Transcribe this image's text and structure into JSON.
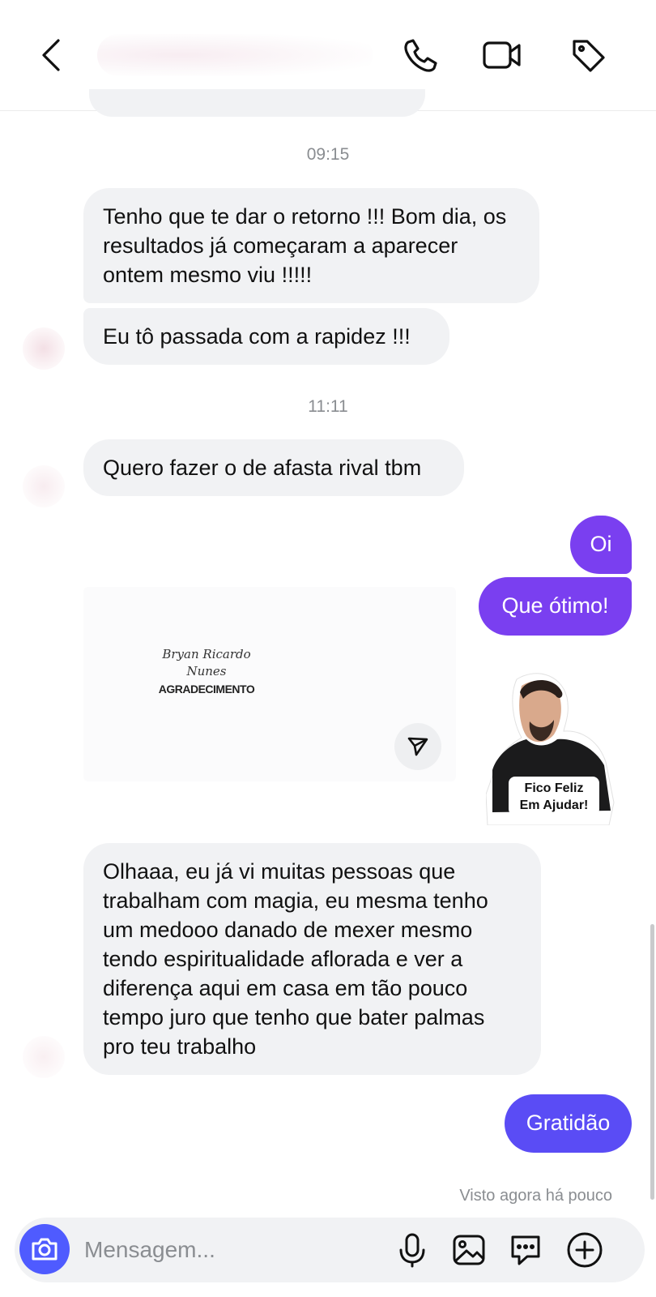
{
  "header": {
    "back_icon": "chevron-left-icon",
    "actions": [
      "phone-icon",
      "video-icon",
      "tag-icon"
    ]
  },
  "colors": {
    "outgoing_bubble": "#7a3ff0",
    "outgoing_bubble_alt": "#5a4cf5",
    "incoming_bubble": "#f1f2f4",
    "camera_button": "#4f5bff"
  },
  "timestamps": [
    "09:15",
    "11:11"
  ],
  "messages": [
    {
      "from": "them",
      "text": "Tenho que te dar o retorno !!! Bom dia, os resultados já começaram a aparecer ontem mesmo viu !!!!!"
    },
    {
      "from": "them",
      "text": "Eu tô passada com a rapidez !!!"
    },
    {
      "from": "them",
      "text": "Quero fazer o de afasta rival tbm"
    },
    {
      "from": "me",
      "text": "Oi"
    },
    {
      "from": "me",
      "text": "Que ótimo!"
    },
    {
      "from": "them",
      "text": "Olhaaa, eu já vi muitas pessoas que trabalham com magia, eu mesma tenho um medooo danado de mexer mesmo tendo espiritualidade aflorada e ver a diferença aqui em casa em tão pouco tempo juro que tenho que bater palmas pro teu trabalho"
    },
    {
      "from": "me",
      "text": "Gratidão"
    }
  ],
  "shared_card": {
    "signature_line1": "Bryan Ricardo",
    "signature_line2": "Nunes",
    "title": "AGRADECIMENTO"
  },
  "sticker": {
    "line1": "Fico Feliz",
    "line2": "Em Ajudar!"
  },
  "seen_status": "Visto agora há pouco",
  "composer": {
    "placeholder": "Mensagem...",
    "icons": [
      "camera-icon",
      "microphone-icon",
      "image-icon",
      "sticker-chat-icon",
      "plus-icon"
    ]
  }
}
